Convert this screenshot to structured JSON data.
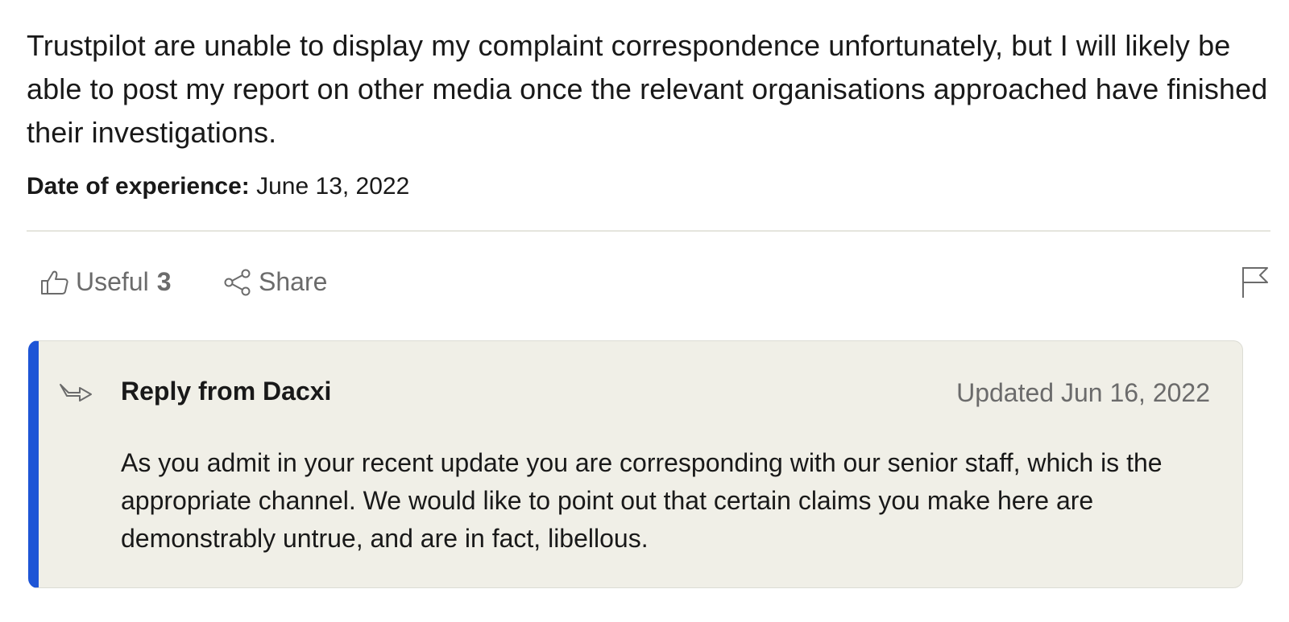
{
  "review": {
    "body": "Trustpilot are unable to display my complaint correspondence unfortunately, but I will likely be able to post my report on other media once the relevant organisations approached have finished their investigations.",
    "date_label": "Date of experience:",
    "date_value": "June 13, 2022"
  },
  "actions": {
    "useful_label": "Useful",
    "useful_count": "3",
    "share_label": "Share",
    "icons": {
      "useful": "thumbs-up-icon",
      "share": "share-icon",
      "flag": "flag-icon"
    }
  },
  "reply": {
    "title": "Reply from Dacxi",
    "updated": "Updated Jun 16, 2022",
    "text": "As you admit in your recent update you are corresponding with our senior staff, which is the appropriate channel. We would like to point out that certain claims you make here are demonstrably untrue, and are in fact, libellous.",
    "icon": "reply-arrow-icon"
  },
  "colors": {
    "accent": "#1e55d6",
    "reply_background": "#f0efe7",
    "muted_text": "#6b6b6b",
    "text": "#191919"
  }
}
